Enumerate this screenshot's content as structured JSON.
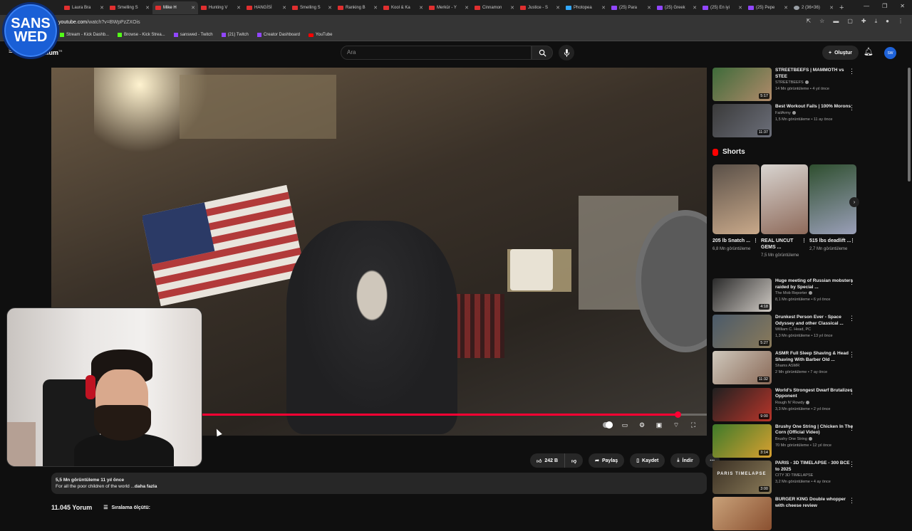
{
  "tabs": [
    {
      "label": "Laura Bra",
      "icon": "youtube-icon"
    },
    {
      "label": "Smelling S",
      "icon": "youtube-icon"
    },
    {
      "label": "Mike H",
      "icon": "youtube-icon",
      "active": true
    },
    {
      "label": "Hunting V",
      "icon": "youtube-icon"
    },
    {
      "label": "HANGİSİ",
      "icon": "youtube-icon"
    },
    {
      "label": "Smelling S",
      "icon": "youtube-icon"
    },
    {
      "label": "Ranking B",
      "icon": "youtube-icon"
    },
    {
      "label": "Kool & Ka",
      "icon": "youtube-icon"
    },
    {
      "label": "Merkür - Y",
      "icon": "youtube-icon"
    },
    {
      "label": "Cinnamon",
      "icon": "youtube-icon"
    },
    {
      "label": "Justice - S",
      "icon": "youtube-icon"
    },
    {
      "label": "Photopea",
      "icon": "photopea-icon"
    },
    {
      "label": "(25) Para",
      "icon": "twitch-icon"
    },
    {
      "label": "(25) Greek",
      "icon": "twitch-icon"
    },
    {
      "label": "(25) En iyi",
      "icon": "twitch-icon"
    },
    {
      "label": "(25) Pepe",
      "icon": "twitch-icon"
    },
    {
      "label": "2 (36×36)",
      "icon": "globe-icon"
    }
  ],
  "browser": {
    "url_prefix": "youtube.com",
    "url_rest": "/watch?v=BWpPzZXOis",
    "new_tab": "+",
    "window_controls": [
      "—",
      "❐",
      "✕"
    ]
  },
  "bookmarks": [
    {
      "label": "Stream - Kick Dashb...",
      "icon": "kick-icon"
    },
    {
      "label": "Browse - Kick Strea...",
      "icon": "kick-icon"
    },
    {
      "label": "sanswed - Twitch",
      "icon": "twitch-icon"
    },
    {
      "label": "(21) Twitch",
      "icon": "twitch-icon"
    },
    {
      "label": "Creator Dashboard",
      "icon": "twitch-icon"
    },
    {
      "label": "YouTube",
      "icon": "youtube-icon"
    }
  ],
  "logo": {
    "line1": "SANS",
    "line2": "WED"
  },
  "youtube": {
    "brand_suffix": "mium",
    "brand_sup": "TR",
    "search_placeholder": "Ara",
    "create_label": "Oluştur",
    "avatar_text": "SW"
  },
  "video": {
    "progress_fraction": 0.955,
    "likes": "242 B",
    "share": "Paylaş",
    "save": "Kaydet",
    "download": "İndir",
    "views_line": "5,5 Mn görüntüleme  11 yıl önce",
    "description": "For all the poor children of the world ...",
    "more": "daha fazla",
    "comments_count": "11.045 Yorum",
    "sort_label": "Sıralama ölçütü:"
  },
  "sidebar_top": [
    {
      "title": "STREETBEEFS | MAMMOTH vs STEE",
      "channel": "STREETBEEFS",
      "verified": true,
      "meta": "14 Mn görüntüleme • 4 yıl önce",
      "duration": "5:17",
      "colors": [
        "#3e6b3a",
        "#b08a6a"
      ]
    },
    {
      "title": "Best Workout Fails | 100% Morons",
      "channel": "FailArmy",
      "verified": true,
      "meta": "1,5 Mn görüntüleme • 11 ay önce",
      "duration": "11:37",
      "colors": [
        "#3a3a3a",
        "#6c6f7a"
      ]
    }
  ],
  "shorts": {
    "title": "Shorts",
    "items": [
      {
        "title": "205 lb Snatch ...",
        "views": "6,8 Mn görüntüleme",
        "colors": [
          "#5a5048",
          "#c9a98a"
        ]
      },
      {
        "title": "REAL UNCUT GEMS ...",
        "views": "7,5 Mn görüntüleme",
        "colors": [
          "#d8d4d0",
          "#8e6a5a"
        ]
      },
      {
        "title": "515 lbs deadlift ...",
        "views": "2,7 Mn görüntüleme",
        "colors": [
          "#2f4f2f",
          "#9a9fb8"
        ]
      }
    ],
    "next": "›"
  },
  "sidebar_bottom": [
    {
      "title": "Huge meeting of Russian mobsters raided by Special ...",
      "channel": "The Mob Reporter",
      "verified": true,
      "meta": "8,1 Mn görüntüleme • 6 yıl önce",
      "duration": "4:18",
      "colors": [
        "#2a2a2a",
        "#cfcac4"
      ]
    },
    {
      "title": "Drunkest Person Ever - Space Odyssey and other Classical ...",
      "channel": "William C. Head, PC",
      "verified": false,
      "meta": "1,3 Mn görüntüleme • 13 yıl önce",
      "duration": "5:27",
      "colors": [
        "#4a5a6a",
        "#8a7a5a"
      ]
    },
    {
      "title": "ASMR Full Sleep Shaving & Head Shaving With Barber Old ...",
      "channel": "Shams ASMR",
      "verified": false,
      "meta": "2 Mn görüntüleme • 7 ay önce",
      "duration": "11:32",
      "colors": [
        "#cfc8bc",
        "#8a6a58"
      ]
    },
    {
      "title": "World's Strongest Dwarf Brutalizes Opponent",
      "channel": "Rough N' Rowdy",
      "verified": true,
      "meta": "3,3 Mn görüntüleme • 2 yıl önce",
      "duration": "9:00",
      "colors": [
        "#202020",
        "#b8352a"
      ]
    },
    {
      "title": "Brushy One String | Chicken In The Corn (Official Video)",
      "channel": "Brushy One String",
      "verified": true,
      "meta": "70 Mn görüntüleme • 12 yıl önce",
      "duration": "3:14",
      "colors": [
        "#3e7a2a",
        "#d8a030"
      ]
    },
    {
      "title": "PARIS - 3D TIMELAPSE - 300 BCE to 2025",
      "channel": "CITY 3D TIMELAPSE",
      "verified": false,
      "meta": "3,2 Mn görüntüleme • 4 ay önce",
      "duration": "3:00",
      "colors": [
        "#3a3024",
        "#8a7a58"
      ],
      "thumb_text": "PARIS TIMELAPSE"
    },
    {
      "title": "BURGER KING Double whopper with cheese review",
      "channel": "",
      "verified": false,
      "meta": "",
      "duration": "",
      "colors": [
        "#c9a27a",
        "#8a5030"
      ]
    }
  ]
}
